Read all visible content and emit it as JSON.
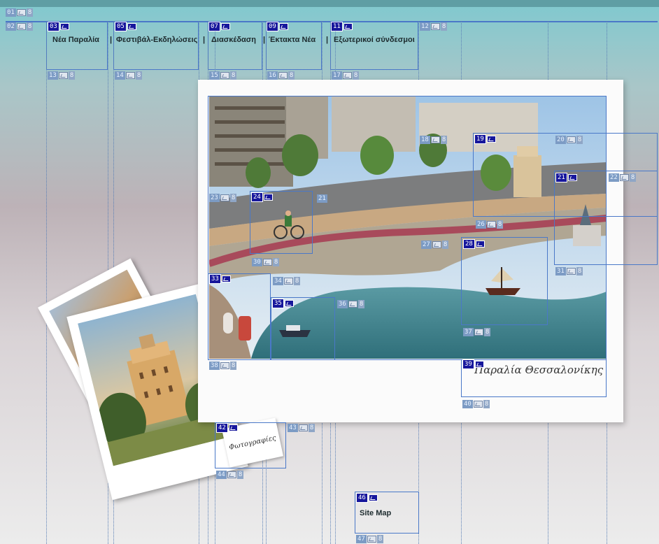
{
  "nav": {
    "items": [
      {
        "label": "Νέα Παραλία"
      },
      {
        "label": "Φεστιβάλ-Εκδηλώσεις"
      },
      {
        "label": "Διασκέδαση"
      },
      {
        "label": "Έκτακτα Νέα"
      },
      {
        "label": "Εξωτερικοί σύνδεσμοι"
      }
    ],
    "separator": "|"
  },
  "main": {
    "caption": "Παραλία Θεσσαλονίκης",
    "photos_label": "Φωτογραφίες",
    "sitemap_label": "Site Map"
  },
  "overlay": {
    "size_mark": "8",
    "slice_numbers": [
      "01",
      "02",
      "03",
      "05",
      "07",
      "09",
      "11",
      "12",
      "13",
      "14",
      "15",
      "16",
      "17",
      "18",
      "19",
      "20",
      "21",
      "22",
      "23",
      "24",
      "26",
      "27",
      "28",
      "30",
      "31",
      "33",
      "34",
      "35",
      "36",
      "37",
      "38",
      "39",
      "40",
      "42",
      "43",
      "44",
      "46",
      "47"
    ]
  },
  "colors": {
    "slice_border": "#4a78c8",
    "tag_dark": "#17179c",
    "tag_light": "#8fa6c6"
  }
}
